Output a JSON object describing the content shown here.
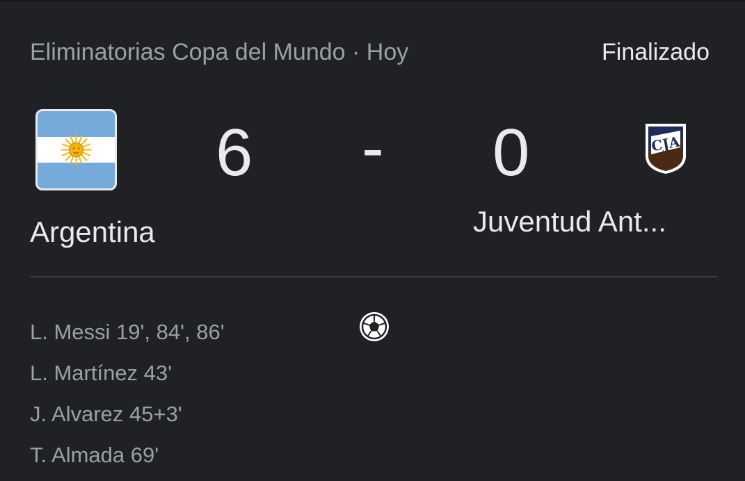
{
  "header": {
    "competition": "Eliminatorias Copa del Mundo · Hoy",
    "status": "Finalizado"
  },
  "match": {
    "home": {
      "name": "Argentina",
      "score": "6",
      "icon": "argentina-flag-icon"
    },
    "separator": "-",
    "away": {
      "name": "Juventud Ant...",
      "score": "0",
      "icon": "cja-crest-icon",
      "crest_text": "CJA"
    }
  },
  "scorers": [
    "L. Messi 19', 84', 86'",
    "L. Martínez 43'",
    "J. Alvarez 45+3'",
    "T. Almada 69'"
  ],
  "goal_icon": "soccer-ball-icon",
  "colors": {
    "background": "#202124",
    "primary_text": "#e8eaed",
    "secondary_text": "#9aa0a6",
    "flag_blue": "#75aadb",
    "flag_sun": "#f6b40e",
    "crest_navy": "#1f2d5c",
    "crest_brown": "#4a2a14"
  }
}
